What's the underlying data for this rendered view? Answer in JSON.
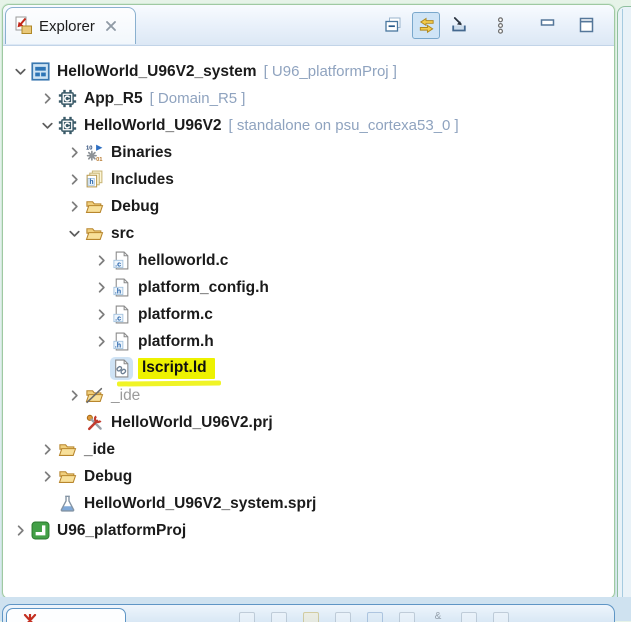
{
  "panel": {
    "tab": {
      "title": "Explorer",
      "icons": [
        "explorer-view-icon",
        "close-icon"
      ]
    },
    "toolbar": {
      "icons": [
        "collapse-all-icon",
        "link-with-editor-icon",
        "focus-icon",
        "view-menu-icon",
        "minimize-icon",
        "maximize-icon"
      ],
      "link_with_editor_toggled": true
    }
  },
  "tree": {
    "rows": [
      {
        "name": "HelloWorld_U96V2_system",
        "suffix": "[ U96_platformProj ]",
        "icon": "system-project-icon",
        "level": 0,
        "expanded": "down"
      },
      {
        "name": "App_R5",
        "suffix": "[ Domain_R5 ]",
        "icon": "application-project-icon",
        "level": 1,
        "expanded": "right"
      },
      {
        "name": "HelloWorld_U96V2",
        "suffix": "[ standalone on psu_cortexa53_0 ]",
        "icon": "application-project-icon",
        "level": 1,
        "expanded": "down"
      },
      {
        "name": "Binaries",
        "icon": "binaries-icon",
        "level": 2,
        "expanded": "right"
      },
      {
        "name": "Includes",
        "icon": "includes-icon",
        "level": 2,
        "expanded": "right"
      },
      {
        "name": "Debug",
        "icon": "folder-open-icon",
        "level": 2,
        "expanded": "right"
      },
      {
        "name": "src",
        "icon": "folder-open-icon",
        "level": 2,
        "expanded": "down"
      },
      {
        "name": "helloworld.c",
        "icon": "c-file-icon",
        "level": 3,
        "expanded": "right"
      },
      {
        "name": "platform_config.h",
        "icon": "h-file-icon",
        "level": 3,
        "expanded": "right"
      },
      {
        "name": "platform.c",
        "icon": "c-file-icon",
        "level": 3,
        "expanded": "right"
      },
      {
        "name": "platform.h",
        "icon": "h-file-icon",
        "level": 3,
        "expanded": "right"
      },
      {
        "name": "lscript.ld",
        "icon": "linker-script-file-icon",
        "level": 3,
        "expanded": "none",
        "selected": true,
        "highlighted": true
      },
      {
        "name": "_ide",
        "icon": "folder-excluded-icon",
        "level": 2,
        "expanded": "right",
        "muted": true
      },
      {
        "name": "HelloWorld_U96V2.prj",
        "icon": "project-tools-icon",
        "level": 2,
        "expanded": "none"
      },
      {
        "name": "_ide",
        "icon": "folder-open-icon",
        "level": 1,
        "expanded": "right"
      },
      {
        "name": "Debug",
        "icon": "folder-open-icon",
        "level": 1,
        "expanded": "right"
      },
      {
        "name": "HelloWorld_U96V2_system.sprj",
        "icon": "flask-icon",
        "level": 1,
        "expanded": "none"
      },
      {
        "name": "U96_platformProj",
        "icon": "platform-project-icon",
        "level": 0,
        "expanded": "right"
      }
    ]
  },
  "colors": {
    "highlight_yellow": "#edf200",
    "selection_blue": "#cfe3f5",
    "suffix_blue_gray": "#8fa3bf",
    "platform_green": "#43a047",
    "panel_border_green": "#9fc9a2",
    "bottom_panel_border_blue": "#5e95c5"
  }
}
